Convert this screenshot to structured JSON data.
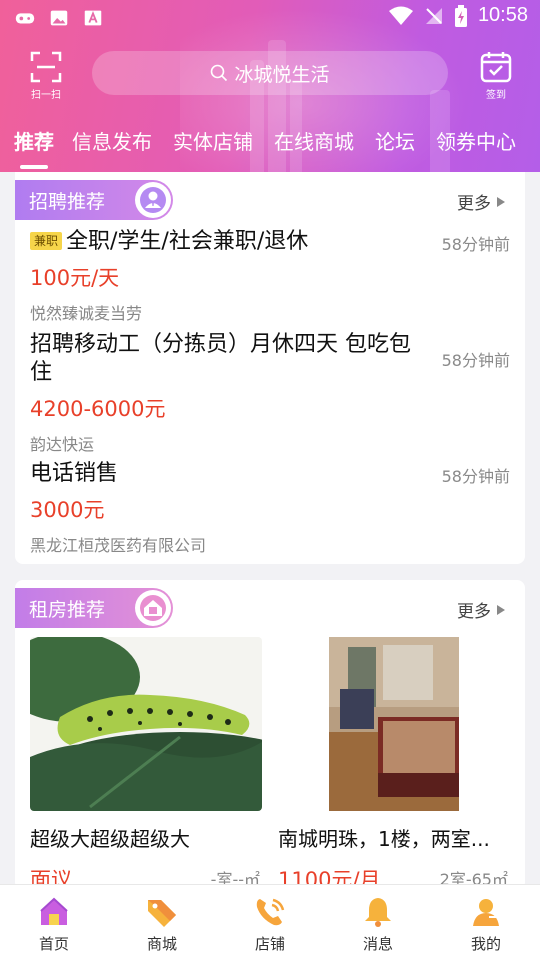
{
  "status_bar": {
    "time": "10:58"
  },
  "header": {
    "scan_label": "扫一扫",
    "search_placeholder": "冰城悦生活",
    "checkin_label": "签到",
    "tabs": [
      "推荐",
      "信息发布",
      "实体店铺",
      "在线商城",
      "论坛",
      "领券中心"
    ]
  },
  "jobs": {
    "title": "招聘推荐",
    "more": "更多",
    "items": [
      {
        "tag": "兼职",
        "title": "全职/学生/社会兼职/退休",
        "time": "58分钟前",
        "salary": "100元/天",
        "company": "悦然臻诚麦当劳"
      },
      {
        "title": "招聘移动工（分拣员）月休四天 包吃包住",
        "time": "58分钟前",
        "salary": "4200-6000元",
        "company": "韵达快运"
      },
      {
        "title": "电话销售",
        "time": "58分钟前",
        "salary": "3000元",
        "company": "黑龙江桓茂医药有限公司"
      }
    ]
  },
  "rent": {
    "title": "租房推荐",
    "more": "更多",
    "items": [
      {
        "name": "超级大超级超级大",
        "price": "面议",
        "spec": "-室--㎡"
      },
      {
        "name": "南城明珠，1楼，两室...",
        "price": "1100元/月",
        "spec": "2室-65㎡"
      }
    ]
  },
  "bottom_nav": [
    {
      "label": "首页",
      "icon": "home-icon"
    },
    {
      "label": "商城",
      "icon": "tag-icon"
    },
    {
      "label": "店铺",
      "icon": "phone-icon"
    },
    {
      "label": "消息",
      "icon": "bell-icon"
    },
    {
      "label": "我的",
      "icon": "user-icon"
    }
  ],
  "colors": {
    "accent": "#e8402a",
    "header_start": "#f0609a",
    "header_end": "#b45ee8",
    "nav_active": "#c95ee0"
  }
}
